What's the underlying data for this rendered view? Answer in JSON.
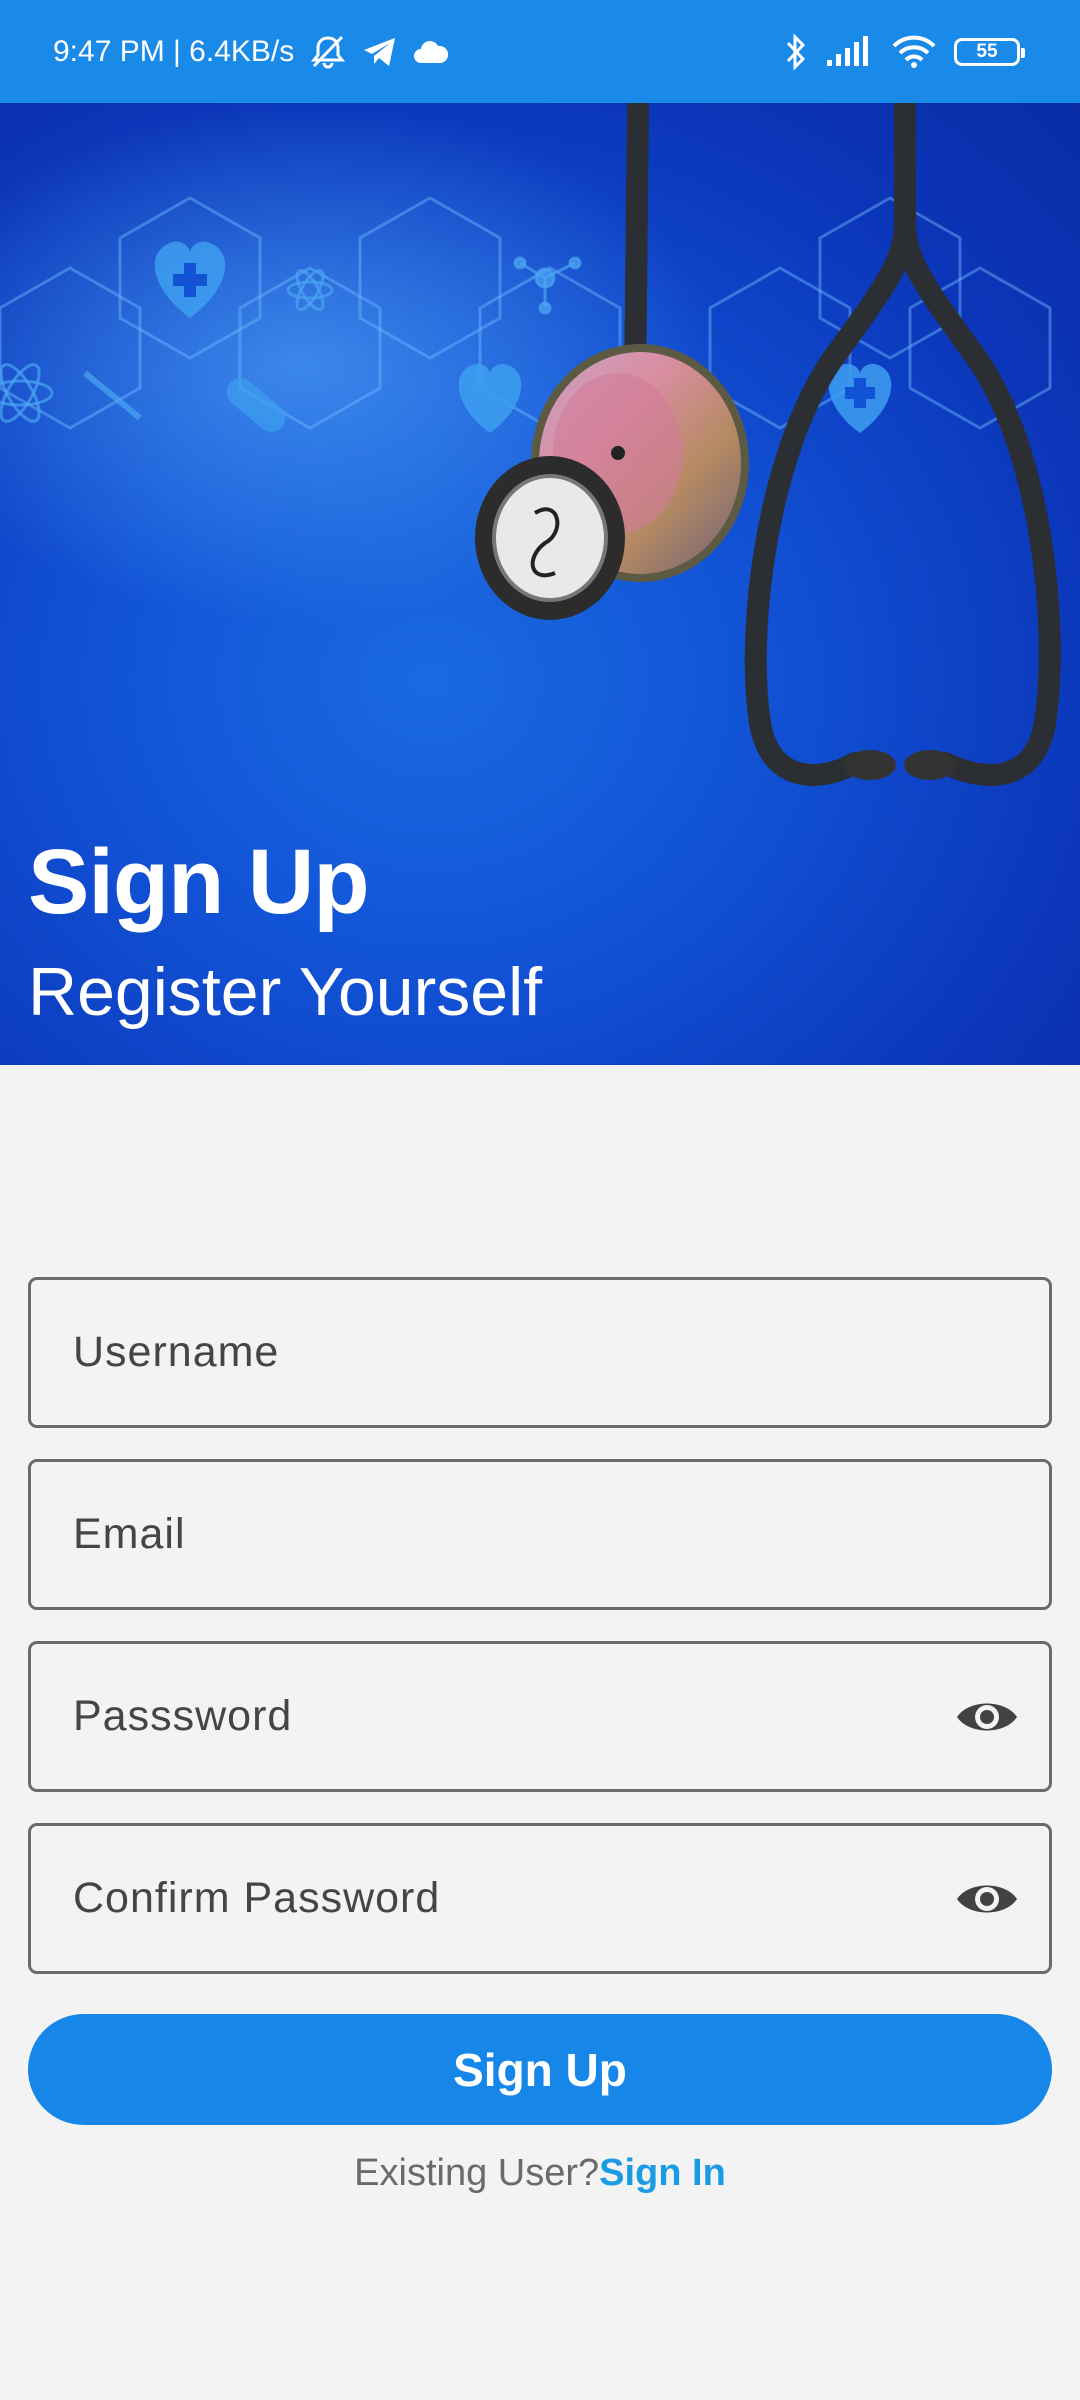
{
  "status_bar": {
    "time_speed": "9:47 PM | 6.4KB/s",
    "battery_level": "55",
    "icons": [
      "mute-bell-icon",
      "telegram-icon",
      "cloud-icon",
      "bluetooth-icon",
      "signal-icon",
      "wifi-icon",
      "battery-icon"
    ]
  },
  "hero": {
    "title": "Sign Up",
    "subtitle": "Register Yourself",
    "background_color": "#1253d6"
  },
  "form": {
    "username_placeholder": "Username",
    "email_placeholder": "Email",
    "password_placeholder": "Passsword",
    "confirm_password_placeholder": "Confirm Password"
  },
  "actions": {
    "signup_label": "Sign Up",
    "existing_user_text": "Existing User?",
    "signin_label": "Sign In"
  },
  "colors": {
    "status_bar": "#1a8ae8",
    "primary_button": "#1686e8",
    "link": "#1a9be3"
  }
}
